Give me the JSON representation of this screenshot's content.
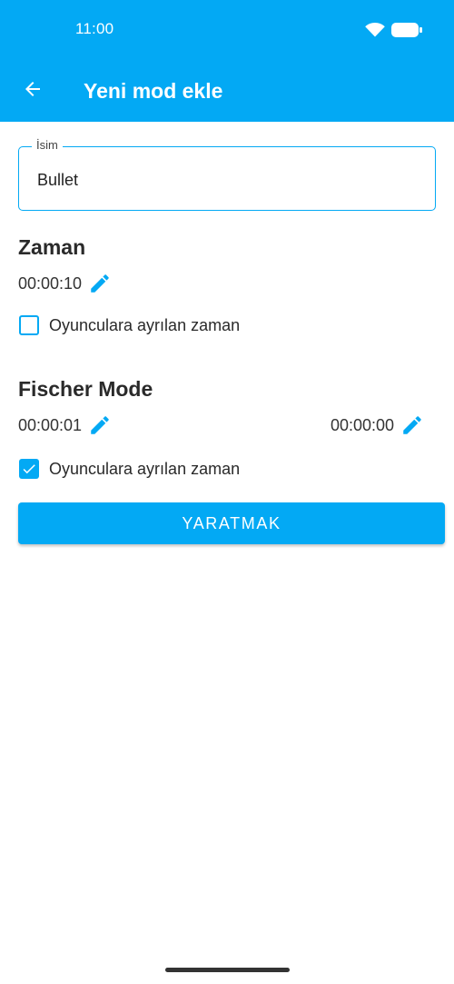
{
  "status_bar": {
    "time": "11:00",
    "icons": [
      "wifi-icon",
      "battery-icon"
    ]
  },
  "app_bar": {
    "title": "Yeni mod ekle",
    "back_icon": "arrow-back-icon",
    "background_color": "#03a9f4"
  },
  "name_field": {
    "label": "İsim",
    "value": "Bullet"
  },
  "time_section": {
    "heading": "Zaman",
    "time_value": "00:00:10",
    "edit_icon": "pencil-icon",
    "checkbox_label": "Oyunculara ayrılan zaman",
    "checkbox_checked": false
  },
  "fischer_section": {
    "heading": "Fischer Mode",
    "left_time_value": "00:00:01",
    "right_time_value": "00:00:00",
    "edit_icon": "pencil-icon",
    "checkbox_label": "Oyunculara ayrılan zaman",
    "checkbox_checked": true
  },
  "create_button": {
    "label": "YARATMAK"
  },
  "colors": {
    "accent": "#03a9f4",
    "text": "#222222",
    "background": "#ffffff"
  }
}
